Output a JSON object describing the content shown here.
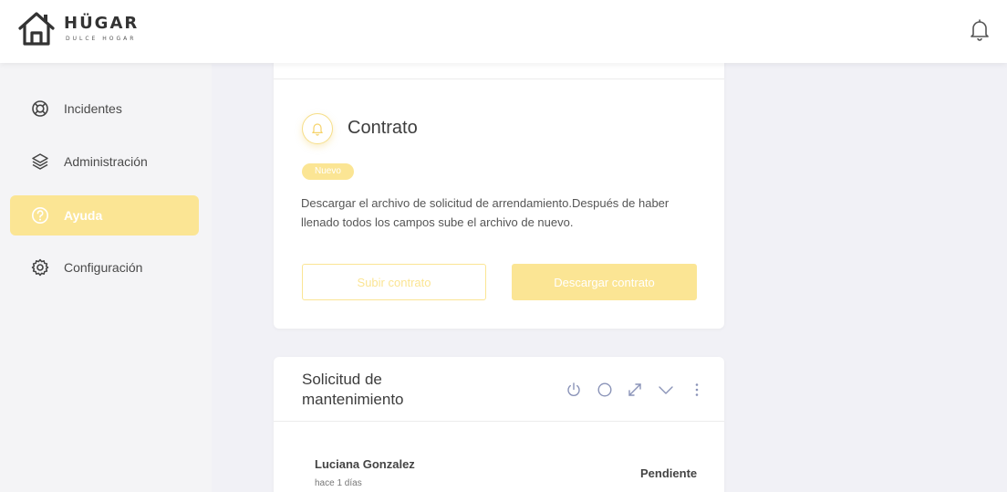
{
  "header": {
    "logo_title": "HÜGAR",
    "logo_subtitle": "DULCE HOGAR"
  },
  "sidebar": {
    "items": [
      {
        "label": "Incidentes",
        "icon": "lifebuoy-icon",
        "active": false
      },
      {
        "label": "Administración",
        "icon": "layers-icon",
        "active": false
      },
      {
        "label": "Ayuda",
        "icon": "help-circle-icon",
        "active": true
      },
      {
        "label": "Configuración",
        "icon": "gear-icon",
        "active": false
      }
    ]
  },
  "contrato_card": {
    "title": "Contrato",
    "badge": "Nuevo",
    "description": "Descargar el archivo de solicitud de arrendamiento.Después de haber llenado todos los campos sube el archivo de nuevo.",
    "upload_label": "Subir contrato",
    "download_label": "Descargar contrato"
  },
  "mantenimiento_card": {
    "title": "Solicitud de mantenimiento",
    "toolbar_icons": [
      "power-icon",
      "circle-icon",
      "expand-icon",
      "chevron-down-icon",
      "more-vertical-icon"
    ],
    "request": {
      "name": "Luciana Gonzalez",
      "time": "hace 1 días",
      "status": "Pendiente"
    }
  },
  "colors": {
    "accent": "#fbe594",
    "background": "#f1f1f6",
    "sidebar": "#f4f4f6",
    "card": "#ffffff"
  }
}
